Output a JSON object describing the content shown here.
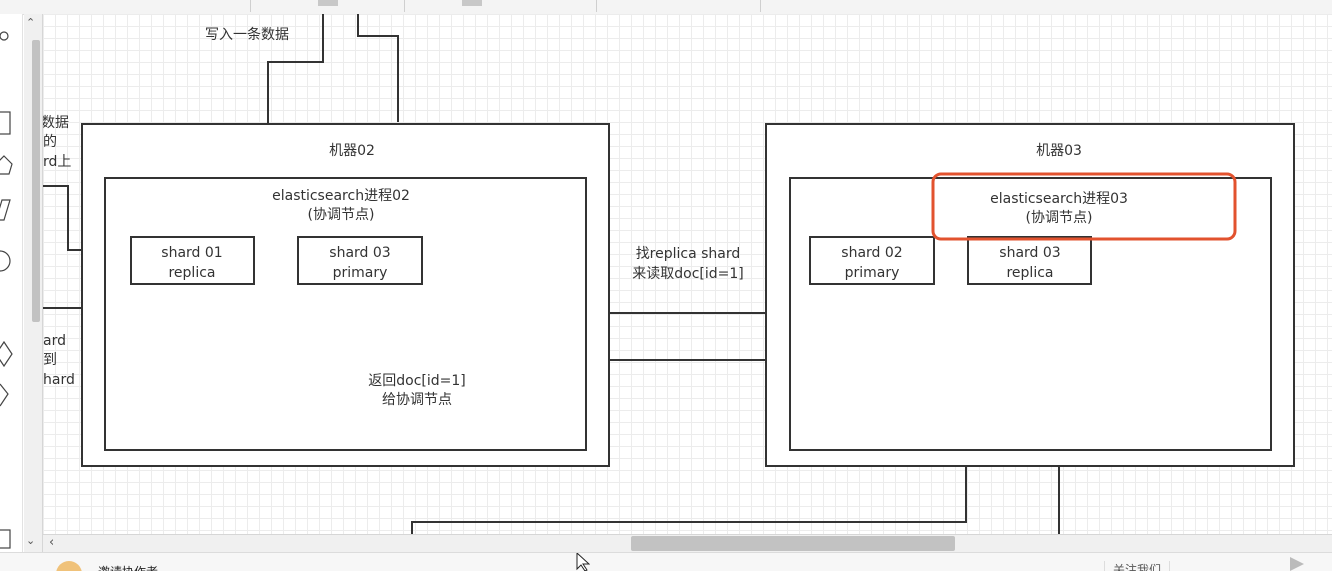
{
  "diagram": {
    "write_label": "写入一条数据",
    "left_cut_top": [
      "数据",
      "的",
      "rd上"
    ],
    "left_cut_bottom": [
      "ard",
      "到",
      "hard"
    ],
    "machine02": {
      "title": "机器02",
      "process": [
        "elasticsearch进程02",
        "(协调节点)"
      ],
      "shard_a": [
        "shard 01",
        "replica"
      ],
      "shard_b": [
        "shard 03",
        "primary"
      ]
    },
    "machine03": {
      "title": "机器03",
      "process": [
        "elasticsearch进程03",
        "(协调节点)"
      ],
      "shard_a": [
        "shard 02",
        "primary"
      ],
      "shard_b": [
        "shard 03",
        "replica"
      ]
    },
    "mid_label": [
      "找replica shard",
      "来读取doc[id=1]"
    ],
    "return_label": [
      "返回doc[id=1]",
      "给协调节点"
    ],
    "highlight_color": "#e2522e"
  },
  "footer": {
    "invite": "邀请协作者",
    "follow": "关注我们"
  }
}
